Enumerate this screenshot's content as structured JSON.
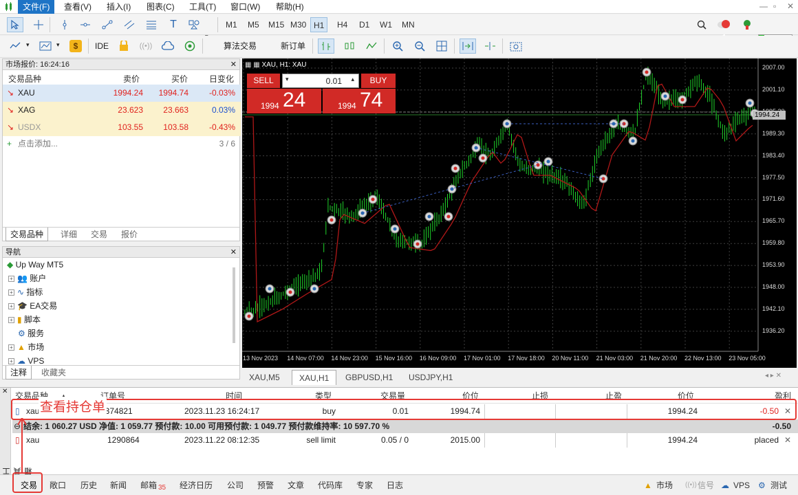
{
  "menu": [
    "文件(F)",
    "查看(V)",
    "插入(I)",
    "图表(C)",
    "工具(T)",
    "窗口(W)",
    "帮助(H)"
  ],
  "timeframes": [
    "M1",
    "M5",
    "M15",
    "M30",
    "H1",
    "H4",
    "D1",
    "W1",
    "MN"
  ],
  "active_timeframe": "H1",
  "notif_count": "1",
  "toolbar2": {
    "ide": "IDE",
    "algo": "算法交易",
    "new_order": "新订单"
  },
  "market_watch": {
    "title": "市场报价: 16:24:16",
    "headers": [
      "交易品种",
      "卖价",
      "买价",
      "日变化"
    ],
    "rows": [
      {
        "symbol": "XAU",
        "bid": "1994.24",
        "ask": "1994.74",
        "change": "-0.03%"
      },
      {
        "symbol": "XAG",
        "bid": "23.623",
        "ask": "23.663",
        "change": "0.03%"
      },
      {
        "symbol": "USDX",
        "bid": "103.55",
        "ask": "103.58",
        "change": "-0.43%"
      }
    ],
    "add_label": "点击添加...",
    "count": "3 / 6",
    "tabs": [
      "交易品种",
      "详细",
      "交易",
      "报价"
    ]
  },
  "navigator": {
    "title": "导航",
    "items": [
      "Up Way MT5",
      "账户",
      "指标",
      "EA交易",
      "脚本",
      "服务",
      "市场",
      "VPS"
    ],
    "tabs": [
      "注释",
      "收藏夹"
    ]
  },
  "chart": {
    "header": "XAU, H1: XAU",
    "sell_label": "SELL",
    "buy_label": "BUY",
    "volume": "0.01",
    "sell_small": "1994",
    "sell_big": "24",
    "buy_small": "1994",
    "buy_big": "74",
    "price_labels": [
      "2007.00",
      "2001.10",
      "1995.20",
      "1989.30",
      "1983.40",
      "1977.50",
      "1971.60",
      "1965.70",
      "1959.80",
      "1953.90",
      "1948.00",
      "1942.10",
      "1936.20"
    ],
    "current_price": "1994.24",
    "time_labels": [
      "13 Nov 2023",
      "14 Nov 07:00",
      "14 Nov 23:00",
      "15 Nov 16:00",
      "16 Nov 09:00",
      "17 Nov 01:00",
      "17 Nov 18:00",
      "20 Nov 11:00",
      "21 Nov 03:00",
      "21 Nov 20:00",
      "22 Nov 13:00",
      "23 Nov 05:00"
    ]
  },
  "chart_tabs": [
    "XAU,M5",
    "XAU,H1",
    "GBPUSD,H1",
    "USDJPY,H1"
  ],
  "active_chart_tab": "XAU,H1",
  "toolbox": {
    "headers": [
      "交易品种",
      "订单号",
      "时间",
      "类型",
      "交易量",
      "价位",
      "止损",
      "止盈",
      "价位",
      "盈利"
    ],
    "position": {
      "symbol": "xau",
      "ticket": "1374821",
      "time": "2023.11.23 16:24:17",
      "type": "buy",
      "volume": "0.01",
      "price": "1994.74",
      "sl": "",
      "tp": "",
      "current": "1994.24",
      "profit": "-0.50"
    },
    "summary": "结余: 1 060.27 USD  净值: 1 059.77  预付款: 10.00  可用预付款: 1 049.77  预付款维持率: 10 597.70 %",
    "summary_profit": "-0.50",
    "order": {
      "symbol": "xau",
      "ticket": "1290864",
      "time": "2023.11.22 08:12:35",
      "type": "sell limit",
      "volume": "0.05 / 0",
      "price": "2015.00",
      "current": "1994.24",
      "status": "placed"
    },
    "side_label": "工具箱",
    "annotation": "查看持仓单"
  },
  "bottom_tabs": [
    "交易",
    "敞口",
    "历史",
    "新闻",
    "邮箱",
    "经济日历",
    "公司",
    "预警",
    "文章",
    "代码库",
    "专家",
    "日志"
  ],
  "mail_count": "35",
  "status": {
    "market": "市场",
    "signal": "信号",
    "vps": "VPS",
    "test": "测试"
  },
  "colors": {
    "accent": "#1e74c6",
    "red": "#e53935",
    "chart_bg": "#000000",
    "candle": "#1fd42a",
    "ma": "#b01818"
  }
}
